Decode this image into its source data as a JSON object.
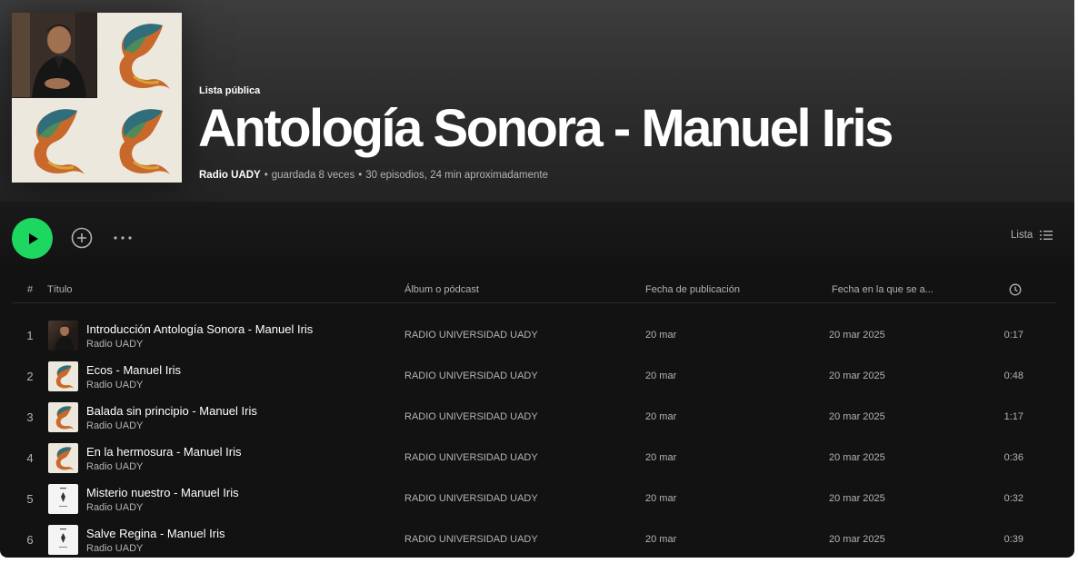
{
  "header": {
    "type_label": "Lista pública",
    "title": "Antología Sonora - Manuel Iris",
    "owner": "Radio UADY",
    "saves": "guardada 8 veces",
    "summary": "30 episodios, 24 min aproximadamente"
  },
  "actions": {
    "view_label": "Lista"
  },
  "columns": {
    "index": "#",
    "title": "Título",
    "album": "Álbum o pódcast",
    "published": "Fecha de publicación",
    "added": "Fecha en la que se a..."
  },
  "tracks": [
    {
      "num": "1",
      "title": "Introducción Antología Sonora - Manuel Iris",
      "artist": "Radio UADY",
      "album": "RADIO UNIVERSIDAD UADY",
      "published": "20 mar",
      "added": "20 mar 2025",
      "duration": "0:17",
      "thumb": "person-photo"
    },
    {
      "num": "2",
      "title": "Ecos - Manuel Iris",
      "artist": "Radio UADY",
      "album": "RADIO UNIVERSIDAD UADY",
      "published": "20 mar",
      "added": "20 mar 2025",
      "duration": "0:48",
      "thumb": "fish-art"
    },
    {
      "num": "3",
      "title": "Balada sin principio - Manuel Iris",
      "artist": "Radio UADY",
      "album": "RADIO UNIVERSIDAD UADY",
      "published": "20 mar",
      "added": "20 mar 2025",
      "duration": "1:17",
      "thumb": "fish-art"
    },
    {
      "num": "4",
      "title": "En la hermosura - Manuel Iris",
      "artist": "Radio UADY",
      "album": "RADIO UNIVERSIDAD UADY",
      "published": "20 mar",
      "added": "20 mar 2025",
      "duration": "0:36",
      "thumb": "fish-art"
    },
    {
      "num": "5",
      "title": "Misterio nuestro - Manuel Iris",
      "artist": "Radio UADY",
      "album": "RADIO UNIVERSIDAD UADY",
      "published": "20 mar",
      "added": "20 mar 2025",
      "duration": "0:32",
      "thumb": "white-cover"
    },
    {
      "num": "6",
      "title": "Salve Regina - Manuel Iris",
      "artist": "Radio UADY",
      "album": "RADIO UNIVERSIDAD UADY",
      "published": "20 mar",
      "added": "20 mar 2025",
      "duration": "0:39",
      "thumb": "white-cover"
    }
  ],
  "colors": {
    "accent": "#1ed760",
    "background": "#121212",
    "text_secondary": "#b3b3b3"
  }
}
